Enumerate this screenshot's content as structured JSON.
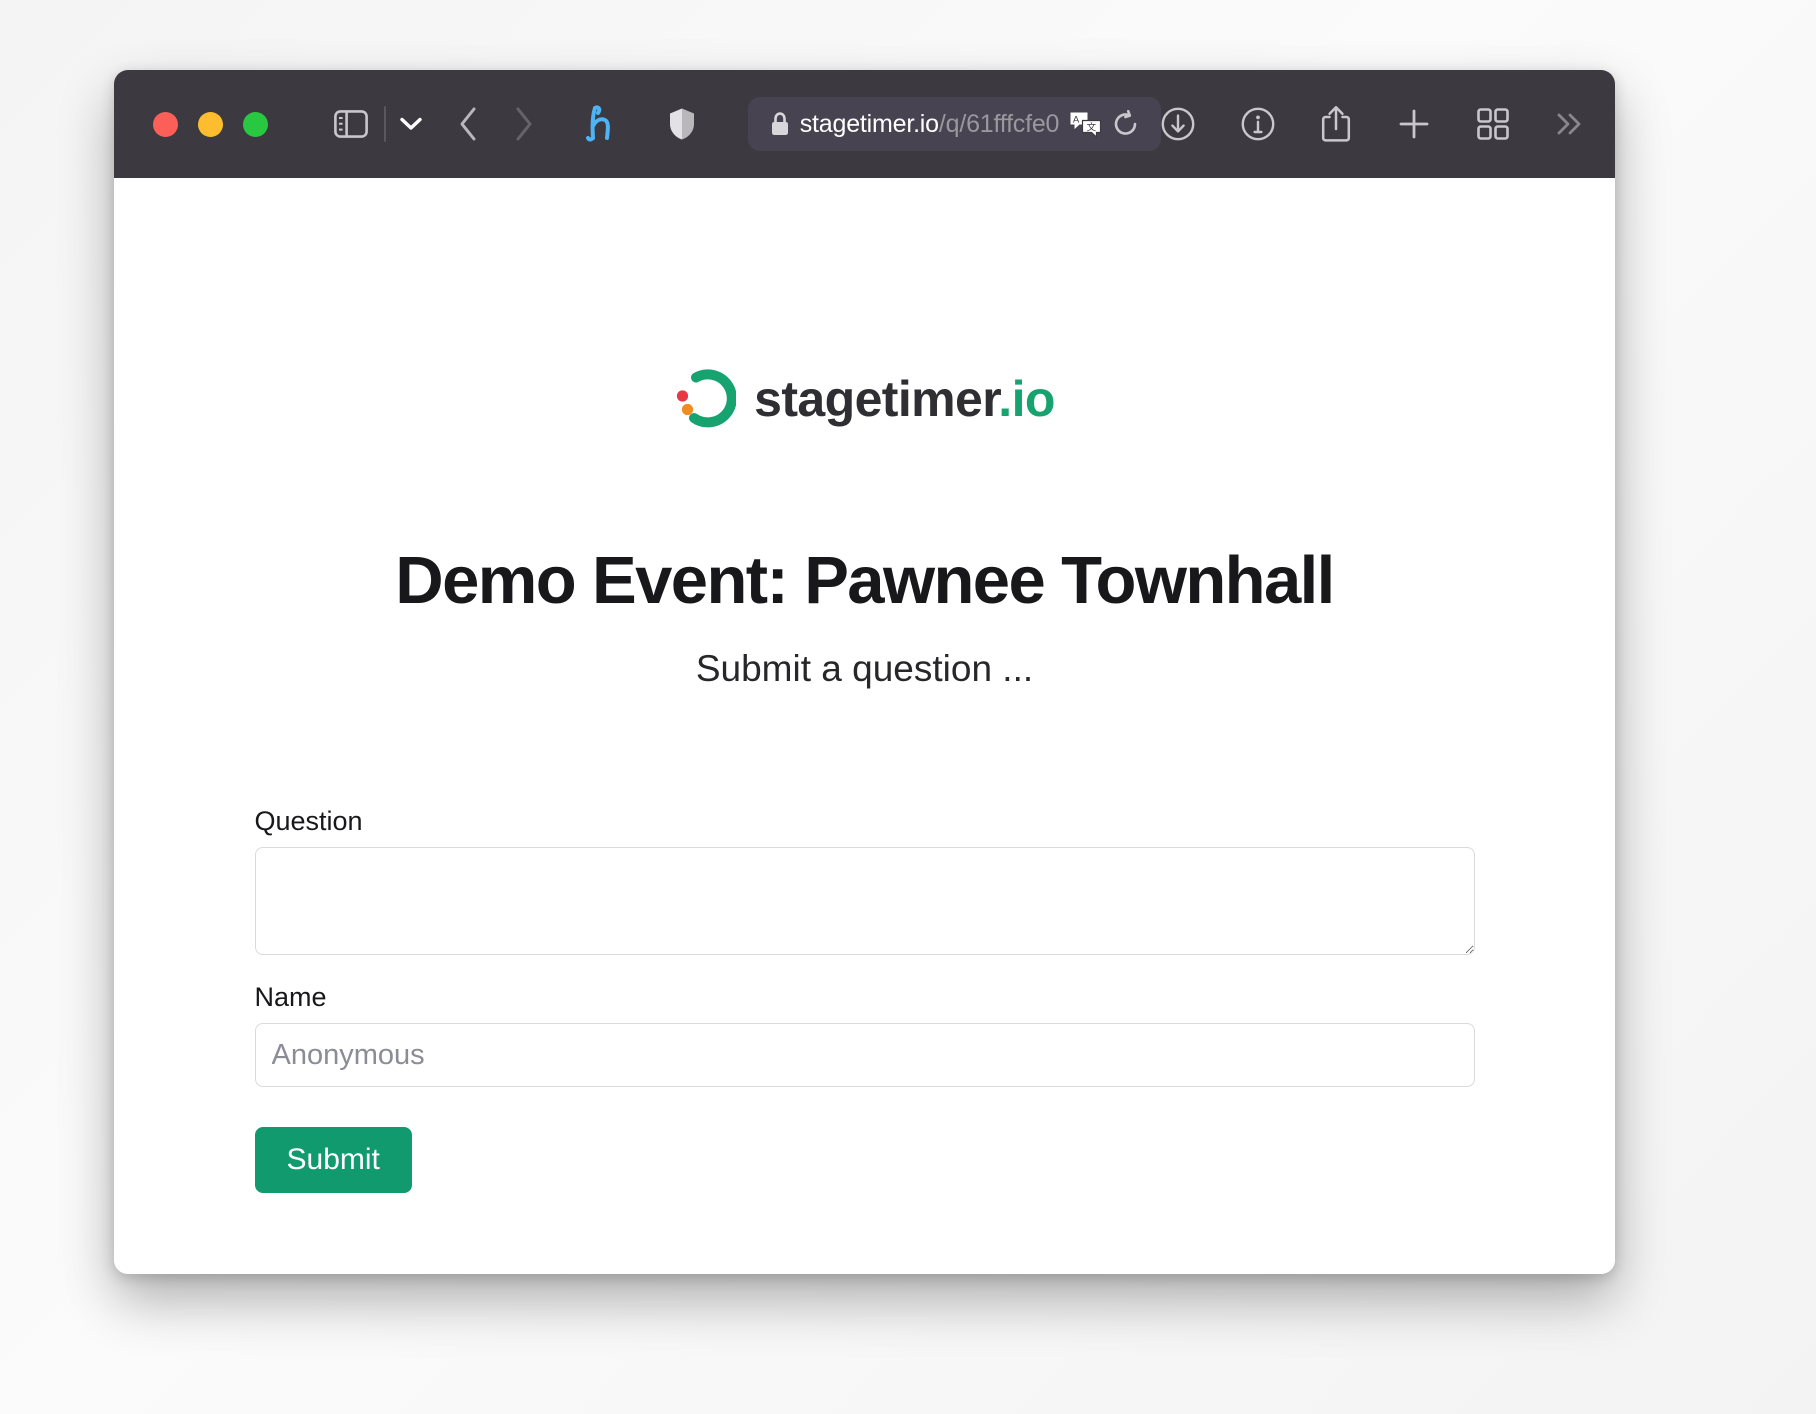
{
  "browser": {
    "window_controls": [
      {
        "name": "close",
        "color": "#fc5f57"
      },
      {
        "name": "minimize",
        "color": "#fdbd2e"
      },
      {
        "name": "maximize",
        "color": "#28c840"
      }
    ],
    "chrome_color": "#3d3941",
    "url_field_color": "#474350",
    "url": "stagetimer.io/q/61fffcfe0",
    "url_domain": "stagetimer.io",
    "url_path": "/q/61fffcfe0",
    "url_secure": true,
    "toolbar_icons": [
      "sidebar-icon",
      "chevron-down-icon",
      "back-icon",
      "forward-icon",
      "hypothesis-icon",
      "shield-icon",
      "lock-icon",
      "translate-icon",
      "reload-icon",
      "downloads-icon",
      "info-icon",
      "share-icon",
      "new-tab-icon",
      "tab-overview-icon",
      "more-icon"
    ],
    "hypothesis_color": "#4db4f5"
  },
  "page": {
    "logo": {
      "wordmark": "stagetimer",
      "tld": ".io",
      "mark_green": "#17a36f",
      "mark_red": "#e63946",
      "mark_orange": "#ef8c22"
    },
    "title": "Demo Event: Pawnee Townhall",
    "subtitle": "Submit a question ...",
    "form": {
      "question": {
        "label": "Question",
        "value": "",
        "placeholder": ""
      },
      "name": {
        "label": "Name",
        "value": "",
        "placeholder": "Anonymous"
      },
      "submit_label": "Submit",
      "submit_color": "#109a6d"
    }
  }
}
